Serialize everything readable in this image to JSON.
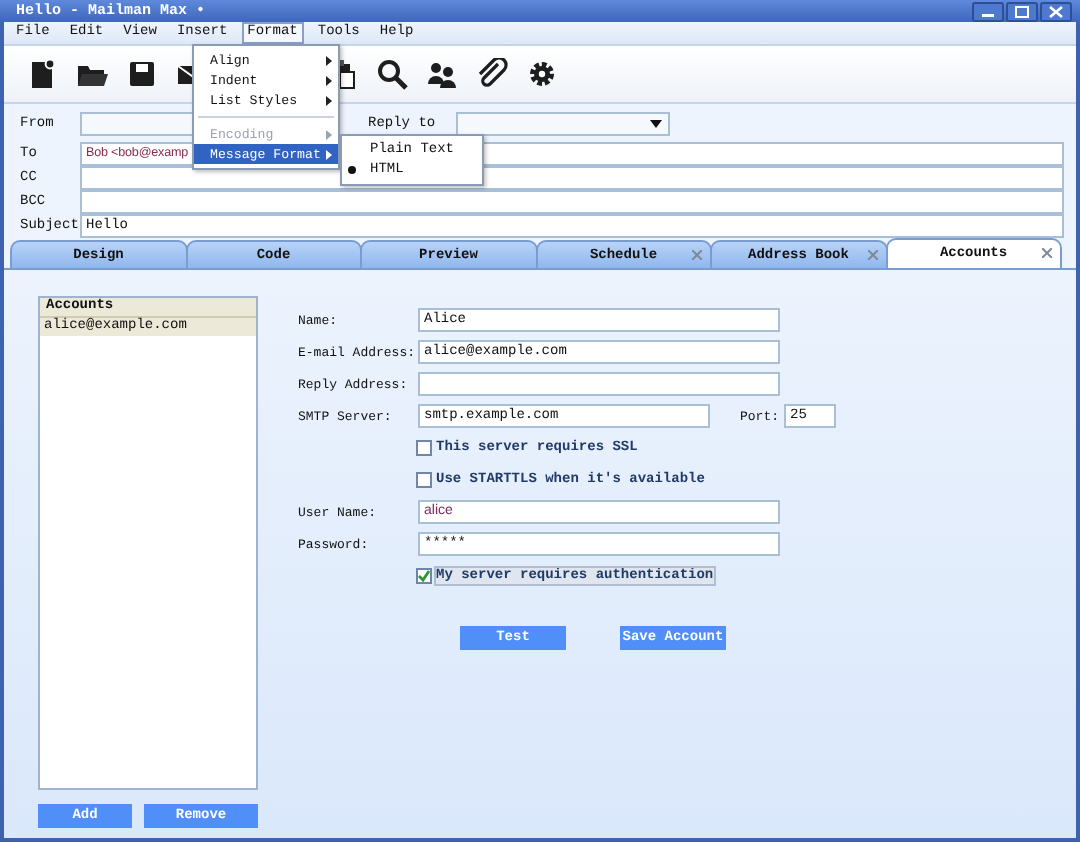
{
  "window": {
    "title": "Hello - Mailman Max •"
  },
  "menu_bar": [
    {
      "label": "File",
      "selected": false
    },
    {
      "label": "Edit",
      "selected": false
    },
    {
      "label": "View",
      "selected": false
    },
    {
      "label": "Insert",
      "selected": false
    },
    {
      "label": "Format",
      "selected": true
    },
    {
      "label": "Tools",
      "selected": false
    },
    {
      "label": "Help",
      "selected": false
    }
  ],
  "open_menu": {
    "items": [
      {
        "kind": "item",
        "label": "Align",
        "submenu": true,
        "disabled": false,
        "selected": false
      },
      {
        "kind": "item",
        "label": "Indent",
        "submenu": true,
        "disabled": false,
        "selected": false
      },
      {
        "kind": "item",
        "label": "List Styles",
        "submenu": true,
        "disabled": false,
        "selected": false
      },
      {
        "kind": "separator"
      },
      {
        "kind": "item",
        "label": "Encoding",
        "submenu": true,
        "disabled": true,
        "selected": false
      },
      {
        "kind": "item",
        "label": "Message Format",
        "submenu": true,
        "disabled": false,
        "selected": true
      }
    ]
  },
  "submenu": {
    "items": [
      {
        "label": "Plain Text",
        "checked": false
      },
      {
        "label": "HTML",
        "checked": true
      }
    ]
  },
  "header": {
    "from": {
      "label": "From"
    },
    "reply_to": {
      "label": "Reply to"
    },
    "fields": [
      {
        "label": "To",
        "value": "Bob <bob@examp"
      },
      {
        "label": "CC"
      },
      {
        "label": "BCC"
      },
      {
        "label": "Subject",
        "value": "Hello"
      }
    ]
  },
  "tabs": [
    {
      "label": "Design",
      "selected": false,
      "closable": false
    },
    {
      "label": "Code",
      "selected": false,
      "closable": false
    },
    {
      "label": "Preview",
      "selected": false,
      "closable": false
    },
    {
      "label": "Schedule",
      "selected": false,
      "closable": true
    },
    {
      "label": "Address Book",
      "selected": false,
      "closable": true
    },
    {
      "label": "Accounts",
      "selected": true,
      "closable": true
    }
  ],
  "accounts": {
    "header": "Accounts",
    "items": [
      {
        "label": "alice@example.com",
        "selected": true
      }
    ],
    "buttons": [
      "Add",
      "Remove"
    ]
  },
  "form": {
    "rows": [
      {
        "kind": "field",
        "label": "Name:",
        "value": "Alice"
      },
      {
        "kind": "field",
        "label": "E-mail Address:",
        "value": "alice@example.com"
      },
      {
        "kind": "field",
        "label": "Reply Address:"
      },
      {
        "kind": "server",
        "label": "SMTP Server:",
        "value": "smtp.example.com",
        "port_label": "Port:",
        "port": "25"
      },
      {
        "kind": "checkbox",
        "label": "This server requires SSL",
        "checked": false
      },
      {
        "kind": "checkbox",
        "label": "Use STARTTLS when it's available",
        "checked": false
      },
      {
        "kind": "field",
        "label": "User Name:",
        "value": "alice"
      },
      {
        "kind": "field",
        "label": "Password:",
        "value": "*****"
      },
      {
        "kind": "checkbox",
        "label": "My server requires authentication",
        "checked": true
      }
    ],
    "buttons": [
      "Test",
      "Save Account"
    ]
  }
}
